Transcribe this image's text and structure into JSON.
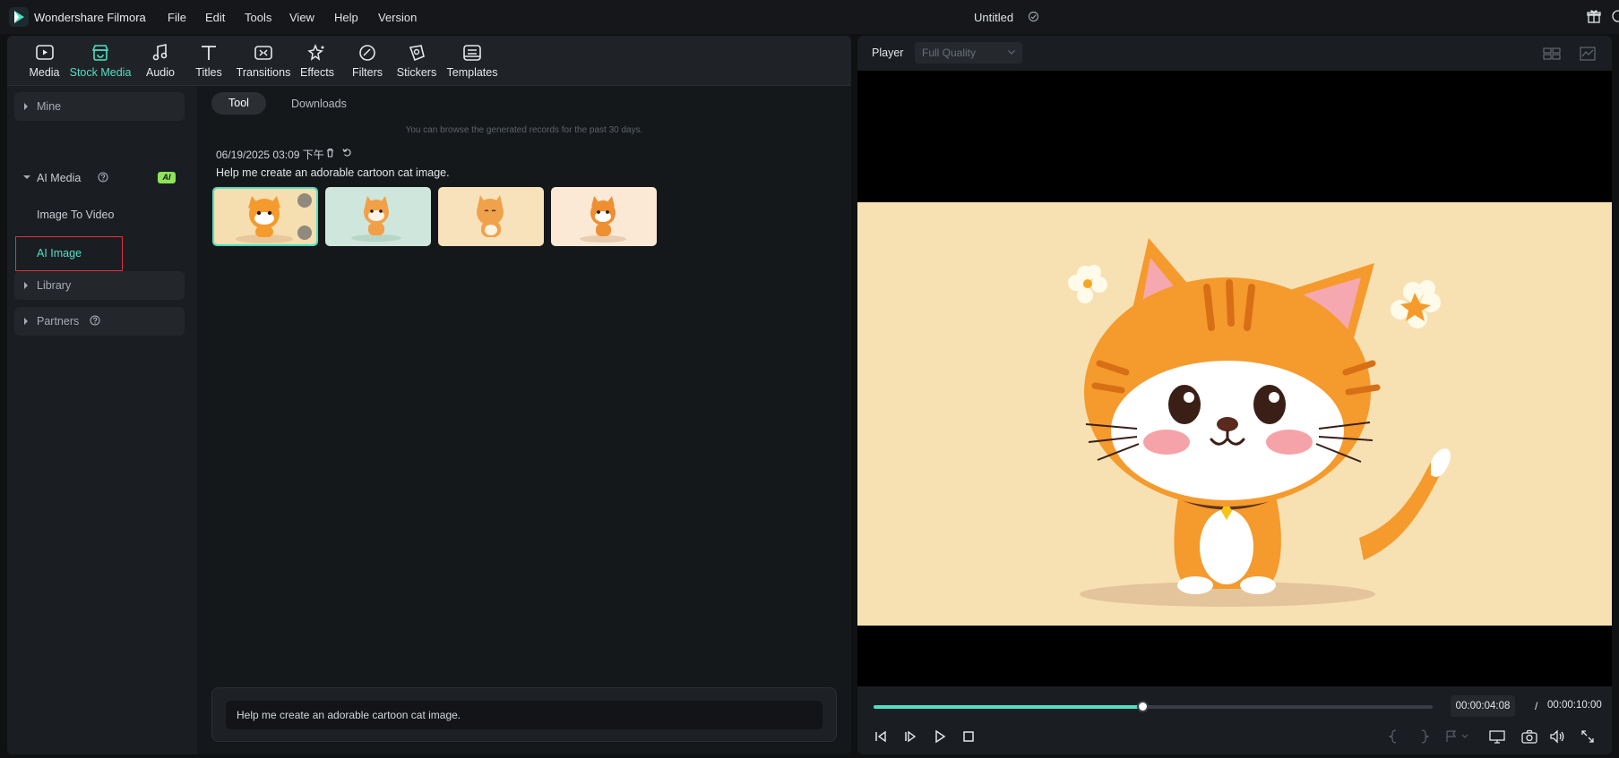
{
  "app": {
    "name": "Wondershare Filmora",
    "document_title": "Untitled",
    "menu": [
      "File",
      "Edit",
      "Tools",
      "View",
      "Help",
      "Version"
    ]
  },
  "toolbar": {
    "items": [
      {
        "label": "Media",
        "icon": "media-icon"
      },
      {
        "label": "Stock Media",
        "icon": "stock-media-icon",
        "active": true
      },
      {
        "label": "Audio",
        "icon": "audio-icon"
      },
      {
        "label": "Titles",
        "icon": "titles-icon"
      },
      {
        "label": "Transitions",
        "icon": "transitions-icon"
      },
      {
        "label": "Effects",
        "icon": "effects-icon"
      },
      {
        "label": "Filters",
        "icon": "filters-icon"
      },
      {
        "label": "Stickers",
        "icon": "stickers-icon"
      },
      {
        "label": "Templates",
        "icon": "templates-icon"
      }
    ]
  },
  "sidebar": {
    "mine": "Mine",
    "ai_media": "AI Media",
    "ai_badge": "AI",
    "image_to_video": "Image To Video",
    "ai_image": "AI Image",
    "library": "Library",
    "partners": "Partners"
  },
  "content": {
    "tabs": {
      "tool": "Tool",
      "downloads": "Downloads"
    },
    "hint": "You can browse the generated records for the past 30 days.",
    "record_date": "06/19/2025 03:09 下午",
    "prompt_label": "Help me create an adorable cartoon cat image.",
    "thumbnails": [
      "cat-thumbnail-1",
      "cat-thumbnail-2",
      "cat-thumbnail-3",
      "cat-thumbnail-4"
    ],
    "thumb_colors": [
      "#f5deb0",
      "#cfe6dc",
      "#f8e2bb",
      "#fbe9d6"
    ],
    "prompt_input": "Help me create an adorable cartoon cat image."
  },
  "player": {
    "label": "Player",
    "quality": "Full Quality",
    "current_time": "00:00:04:08",
    "separator": "/",
    "total_time": "00:00:10:00",
    "progress": 0.48
  },
  "colors": {
    "accent": "#4fe0c4",
    "highlight_box": "#e0323a",
    "frame_bg": "#f7e1b3",
    "cat_orange": "#f59a2c"
  }
}
